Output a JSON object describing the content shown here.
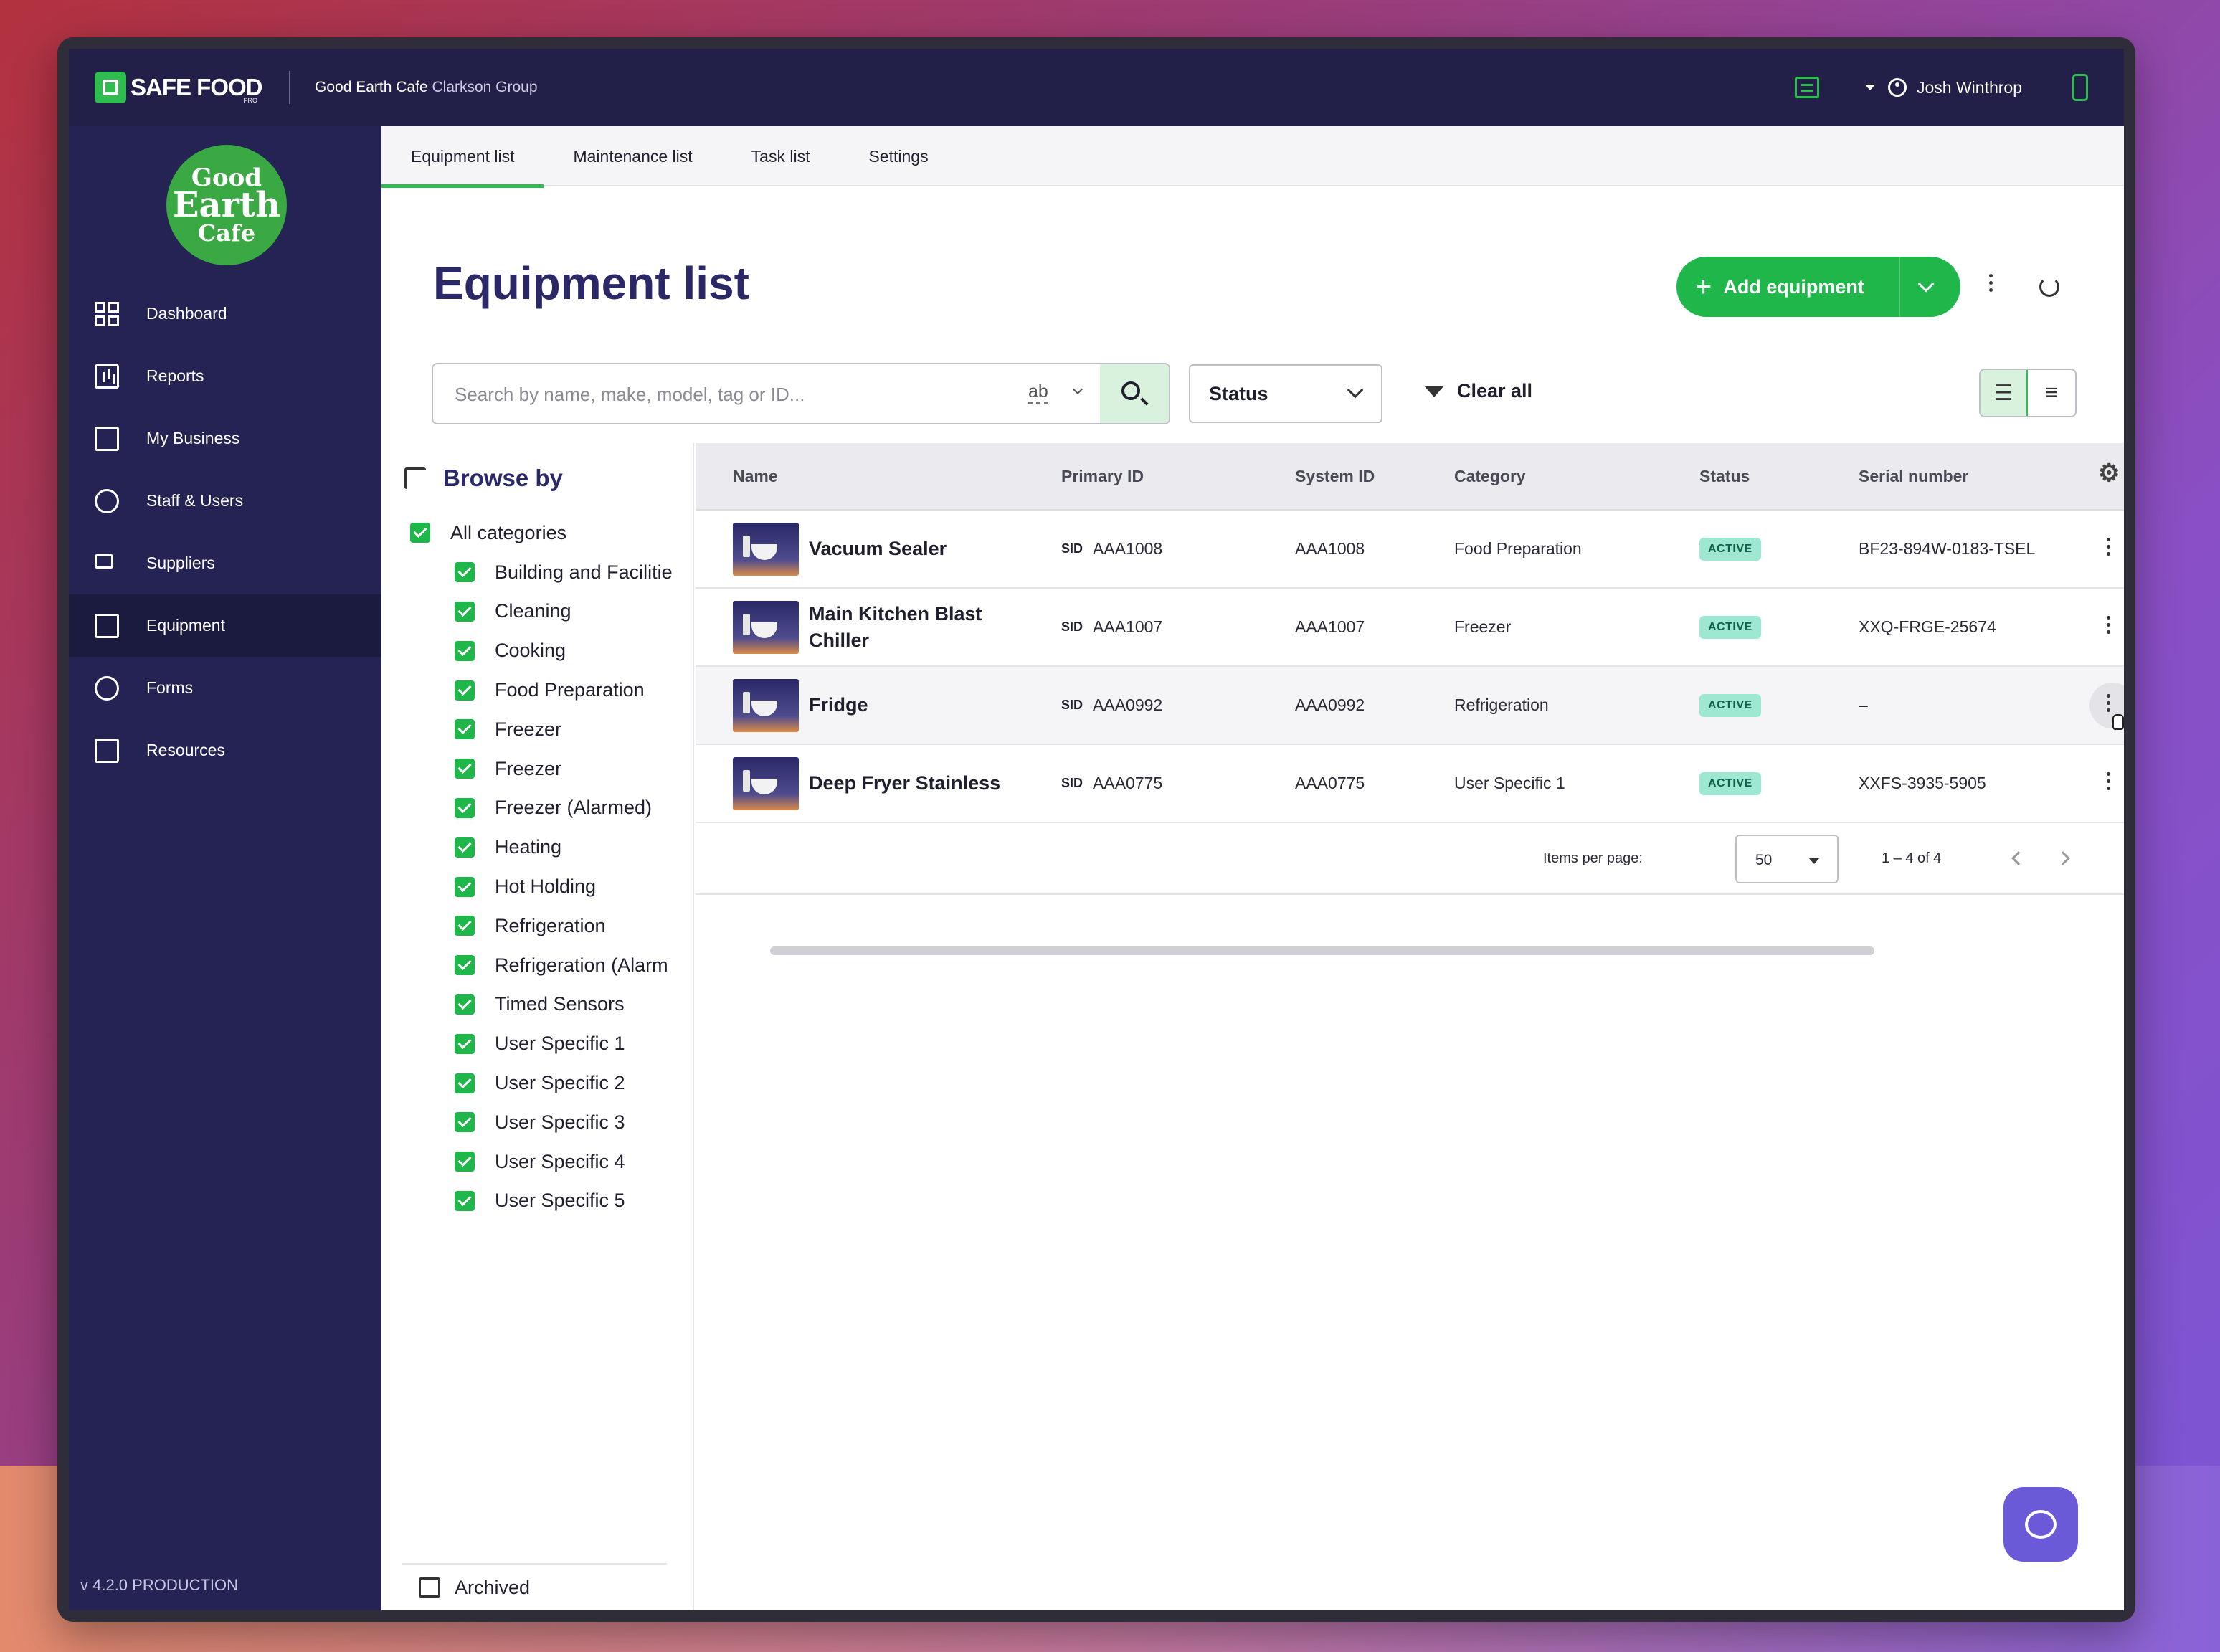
{
  "header": {
    "logo_text": "SAFE FOOD",
    "logo_sub": "PRO",
    "org_name": "Good Earth Cafe",
    "org_group": "Clarkson Group",
    "user_name": "Josh Winthrop"
  },
  "brand": {
    "line1": "Good",
    "line2": "Earth",
    "line3": "Cafe"
  },
  "sidebar": {
    "items": [
      {
        "label": "Dashboard",
        "icon": "dashboard-icon"
      },
      {
        "label": "Reports",
        "icon": "reports-icon"
      },
      {
        "label": "My Business",
        "icon": "store-icon"
      },
      {
        "label": "Staff & Users",
        "icon": "staff-icon"
      },
      {
        "label": "Suppliers",
        "icon": "truck-icon"
      },
      {
        "label": "Equipment",
        "icon": "equipment-icon",
        "active": true
      },
      {
        "label": "Forms",
        "icon": "check-circle-icon"
      },
      {
        "label": "Resources",
        "icon": "copy-icon"
      }
    ],
    "version": "v 4.2.0 PRODUCTION"
  },
  "tabs": [
    {
      "label": "Equipment list",
      "active": true
    },
    {
      "label": "Maintenance list"
    },
    {
      "label": "Task list"
    },
    {
      "label": "Settings"
    }
  ],
  "page": {
    "title": "Equipment list",
    "add_label": "Add equipment"
  },
  "search": {
    "placeholder": "Search by name, make, model, tag or ID...",
    "mode": "ab"
  },
  "filters": {
    "status_label": "Status",
    "clear_label": "Clear all"
  },
  "browse": {
    "title": "Browse by",
    "all_label": "All categories",
    "categories": [
      "Building and Facilitie",
      "Cleaning",
      "Cooking",
      "Food Preparation",
      "Freezer",
      "Freezer",
      "Freezer (Alarmed)",
      "Heating",
      "Hot Holding",
      "Refrigeration",
      "Refrigeration (Alarm",
      "Timed Sensors",
      "User Specific 1",
      "User Specific 2",
      "User Specific 3",
      "User Specific 4",
      "User Specific 5"
    ],
    "archived_label": "Archived"
  },
  "table": {
    "columns": [
      "Name",
      "Primary ID",
      "System ID",
      "Category",
      "Status",
      "Serial number"
    ],
    "rows": [
      {
        "name": "Vacuum Sealer",
        "primary_tag": "SID",
        "primary_id": "AAA1008",
        "system_id": "AAA1008",
        "category": "Food Preparation",
        "status": "ACTIVE",
        "serial": "BF23-894W-0183-TSEL"
      },
      {
        "name": "Main Kitchen Blast Chiller",
        "primary_tag": "SID",
        "primary_id": "AAA1007",
        "system_id": "AAA1007",
        "category": "Freezer",
        "status": "ACTIVE",
        "serial": "XXQ-FRGE-25674"
      },
      {
        "name": "Fridge",
        "primary_tag": "SID",
        "primary_id": "AAA0992",
        "system_id": "AAA0992",
        "category": "Refrigeration",
        "status": "ACTIVE",
        "serial": "–"
      },
      {
        "name": "Deep Fryer Stainless",
        "primary_tag": "SID",
        "primary_id": "AAA0775",
        "system_id": "AAA0775",
        "category": "User Specific 1",
        "status": "ACTIVE",
        "serial": "XXFS-3935-5905"
      }
    ]
  },
  "pagination": {
    "items_label": "Items per page:",
    "per_page": "50",
    "range": "1 – 4 of 4"
  },
  "colors": {
    "accent": "#1fb64a",
    "navy": "#252354",
    "badge_bg": "#9ee8d2"
  }
}
